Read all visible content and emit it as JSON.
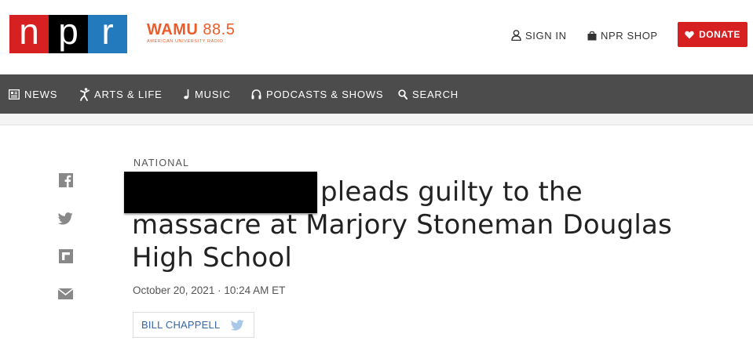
{
  "header": {
    "logo": {
      "letters": [
        "n",
        "p",
        "r"
      ],
      "colors": [
        "#d62021",
        "#000000",
        "#237bbd"
      ]
    },
    "station": {
      "name_bold": "WAMU",
      "name_freq": "88.5",
      "subtitle": "AMERICAN UNIVERSITY RADIO",
      "color": "#ec5b2a"
    },
    "sign_in_label": "SIGN IN",
    "shop_label": "NPR SHOP",
    "donate_label": "DONATE",
    "donate_color": "#d62021"
  },
  "nav": {
    "background": "#4c4c4c",
    "items": [
      {
        "label": "NEWS",
        "icon": "newspaper-icon"
      },
      {
        "label": "ARTS & LIFE",
        "icon": "dancer-icon"
      },
      {
        "label": "MUSIC",
        "icon": "music-note-icon"
      },
      {
        "label": "PODCASTS & SHOWS",
        "icon": "headphones-icon"
      },
      {
        "label": "SEARCH",
        "icon": "search-icon"
      }
    ]
  },
  "share": [
    "facebook-icon",
    "twitter-icon",
    "flipboard-icon",
    "email-icon"
  ],
  "article": {
    "slug": "NATIONAL",
    "headline_lines": [
      "pleads guilty to the",
      "massacre at Marjory Stoneman Douglas",
      "High School"
    ],
    "dateline": "October 20, 2021 · 10:24 AM ET",
    "byline": "BILL CHAPPELL"
  }
}
